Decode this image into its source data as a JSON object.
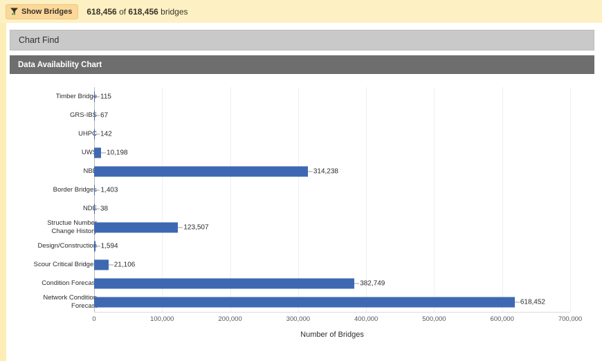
{
  "toolbar": {
    "show_bridges_label": "Show Bridges",
    "filter_icon": "funnel-filter-icon",
    "count_prefix": "618,456",
    "count_middle": " of ",
    "count_suffix": "618,456",
    "count_unit": " bridges",
    "count_full": "618,456 of 618,456 bridges",
    "background_color": "#fdf1c4",
    "button_color": "#fbd89a"
  },
  "panels": {
    "chart_find_title": "Chart Find",
    "chart_find_color": "#c9c9c9",
    "data_availability_title": "Data Availability Chart",
    "data_availability_color": "#6e6e6e"
  },
  "chart_data": {
    "type": "bar",
    "orientation": "horizontal",
    "title": "Data Availability Chart",
    "xlabel": "Number of Bridges",
    "ylabel": "",
    "xlim": [
      0,
      700000
    ],
    "xticks": [
      "0",
      "100,000",
      "200,000",
      "300,000",
      "400,000",
      "500,000",
      "600,000",
      "700,000"
    ],
    "xtick_values": [
      0,
      100000,
      200000,
      300000,
      400000,
      500000,
      600000,
      700000
    ],
    "grid": true,
    "legend": false,
    "bar_color": "#3e69b2",
    "categories": [
      "Timber Bridge",
      "GRS-IBS",
      "UHPC",
      "UWS",
      "NBE",
      "Border Bridges",
      "NDE",
      "Structue Number Change History",
      "Design/Construction",
      "Scour Critical Bridges",
      "Condition Forecast",
      "Network Condition Forecast"
    ],
    "values": [
      115,
      67,
      142,
      10198,
      314238,
      1403,
      38,
      123507,
      1594,
      21106,
      382749,
      618452
    ],
    "value_labels": [
      "115",
      "67",
      "142",
      "10,198",
      "314,238",
      "1,403",
      "38",
      "123,507",
      "1,594",
      "21,106",
      "382,749",
      "618,452"
    ],
    "category_lines": [
      [
        "Timber Bridge"
      ],
      [
        "GRS-IBS"
      ],
      [
        "UHPC"
      ],
      [
        "UWS"
      ],
      [
        "NBE"
      ],
      [
        "Border Bridges"
      ],
      [
        "NDE"
      ],
      [
        "Structue Number",
        "Change History"
      ],
      [
        "Design/Construction"
      ],
      [
        "Scour Critical Bridges"
      ],
      [
        "Condition Forecast"
      ],
      [
        "Network Condition",
        "Forecast"
      ]
    ]
  }
}
